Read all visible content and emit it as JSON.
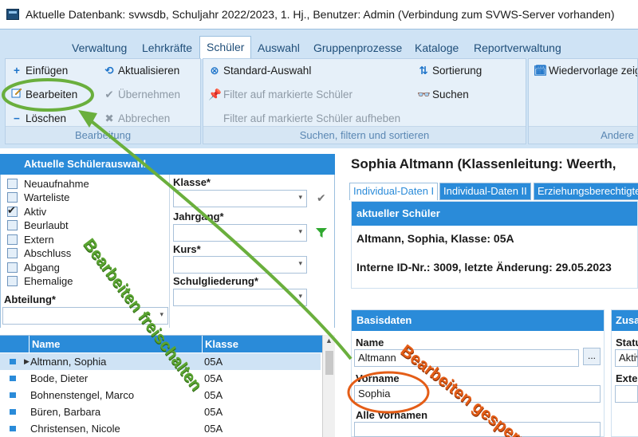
{
  "window": {
    "title": "Aktuelle Datenbank: svwsdb, Schuljahr 2022/2023, 1. Hj., Benutzer: Admin (Verbindung zum SVWS-Server vorhanden)"
  },
  "ribbon": {
    "tabs": [
      "Verwaltung",
      "Lehrkräfte",
      "Schüler",
      "Auswahl",
      "Gruppenprozesse",
      "Kataloge",
      "Reportverwaltung"
    ],
    "active_tab": "Schüler",
    "groups": {
      "bearbeitung": {
        "label": "Bearbeitung",
        "einfuegen": "Einfügen",
        "bearbeiten": "Bearbeiten",
        "loeschen": "Löschen",
        "aktualisieren": "Aktualisieren",
        "uebernehmen": "Übernehmen",
        "abbrechen": "Abbrechen"
      },
      "suchen": {
        "label": "Suchen, filtern und sortieren",
        "standard_auswahl": "Standard-Auswahl",
        "filter_markierte": "Filter auf markierte Schüler",
        "filter_aufheben": "Filter auf markierte Schüler aufheben",
        "sortierung": "Sortierung",
        "suchen": "Suchen"
      },
      "andere": {
        "label": "Andere",
        "wiedervorlage": "Wiedervorlage zeig"
      }
    }
  },
  "auswahl": {
    "header": "Aktuelle Schülerauswahl",
    "status": [
      {
        "label": "Neuaufnahme",
        "checked": false
      },
      {
        "label": "Warteliste",
        "checked": false
      },
      {
        "label": "Aktiv",
        "checked": true
      },
      {
        "label": "Beurlaubt",
        "checked": false
      },
      {
        "label": "Extern",
        "checked": false
      },
      {
        "label": "Abschluss",
        "checked": false
      },
      {
        "label": "Abgang",
        "checked": false
      },
      {
        "label": "Ehemalige",
        "checked": false
      }
    ],
    "abteilung_label": "Abteilung*",
    "klasse_label": "Klasse*",
    "jahrgang_label": "Jahrgang*",
    "kurs_label": "Kurs*",
    "schulgliederung_label": "Schulgliederung*"
  },
  "table": {
    "columns": [
      "Name",
      "Klasse"
    ],
    "rows": [
      {
        "name": "Altmann, Sophia",
        "klasse": "05A",
        "selected": true
      },
      {
        "name": "Bode, Dieter",
        "klasse": "05A",
        "selected": false
      },
      {
        "name": "Bohnenstengel, Marco",
        "klasse": "05A",
        "selected": false
      },
      {
        "name": "Büren, Barbara",
        "klasse": "05A",
        "selected": false
      },
      {
        "name": "Christensen, Nicole",
        "klasse": "05A",
        "selected": false
      }
    ]
  },
  "detail": {
    "title": "Sophia Altmann (Klassenleitung: Weerth,",
    "tabs": [
      "Individual-Daten I",
      "Individual-Daten II",
      "Erziehungsberechtigte"
    ],
    "active_tab": "Individual-Daten I",
    "current": {
      "header": "aktueller Schüler",
      "line1": "Altmann, Sophia, Klasse: 05A",
      "line2": "Interne ID-Nr.: 3009, letzte Änderung: 29.05.2023"
    },
    "basisdaten": {
      "header": "Basisdaten",
      "name_label": "Name",
      "name_value": "Altmann",
      "dots_label": "...",
      "vorname_label": "Vorname",
      "vorname_value": "Sophia",
      "alle_vornamen_label": "Alle Vornamen"
    },
    "zusatz": {
      "header": "Zusa",
      "status_label": "Statu",
      "status_value": "Aktiv",
      "extern_label": "Exter"
    }
  },
  "annotations": {
    "green_text": "Bearbeiten freischalten",
    "orange_text": "Bearbeiten gesperrt",
    "green_color": "#5aa431",
    "orange_color": "#e45d17"
  }
}
